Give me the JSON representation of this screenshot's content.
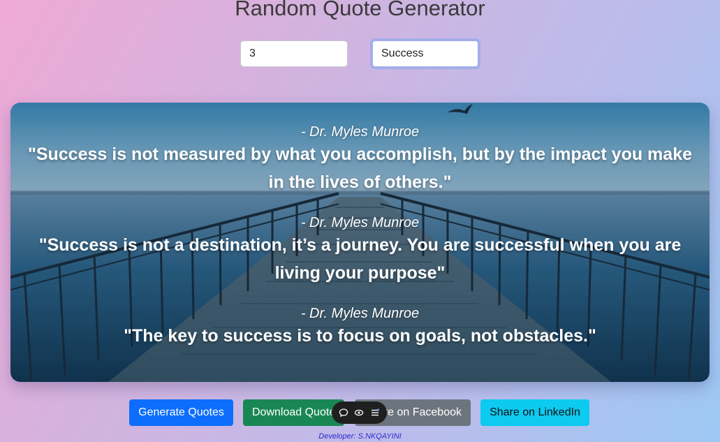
{
  "page": {
    "title": "Random Quote Generator"
  },
  "controls": {
    "count_value": "3",
    "category_value": "Success"
  },
  "quotes": [
    {
      "author": "- Dr. Myles Munroe",
      "text": "\"Success is not measured by what you accomplish, but by the impact you make in the lives of others.\""
    },
    {
      "author": "- Dr. Myles Munroe",
      "text": "\"Success is not a destination, it’s a journey. You are successful when you are living your purpose\""
    },
    {
      "author": "- Dr. Myles Munroe",
      "text": "\"The key to success is to focus on goals, not obstacles.\""
    }
  ],
  "buttons": {
    "generate": "Generate Quotes",
    "download": "Download Quotes",
    "facebook": "Share on Facebook",
    "linkedin": "Share on LinkedIn"
  },
  "toolbar": {
    "icons": [
      "comment-icon",
      "eye-icon",
      "menu-icon"
    ]
  },
  "footer": {
    "developer": "Developer: S.NKQAYINI"
  },
  "colors": {
    "generate": "#0d6efd",
    "download": "#198754",
    "facebook": "#6c757d",
    "linkedin": "#0dcaf0"
  }
}
